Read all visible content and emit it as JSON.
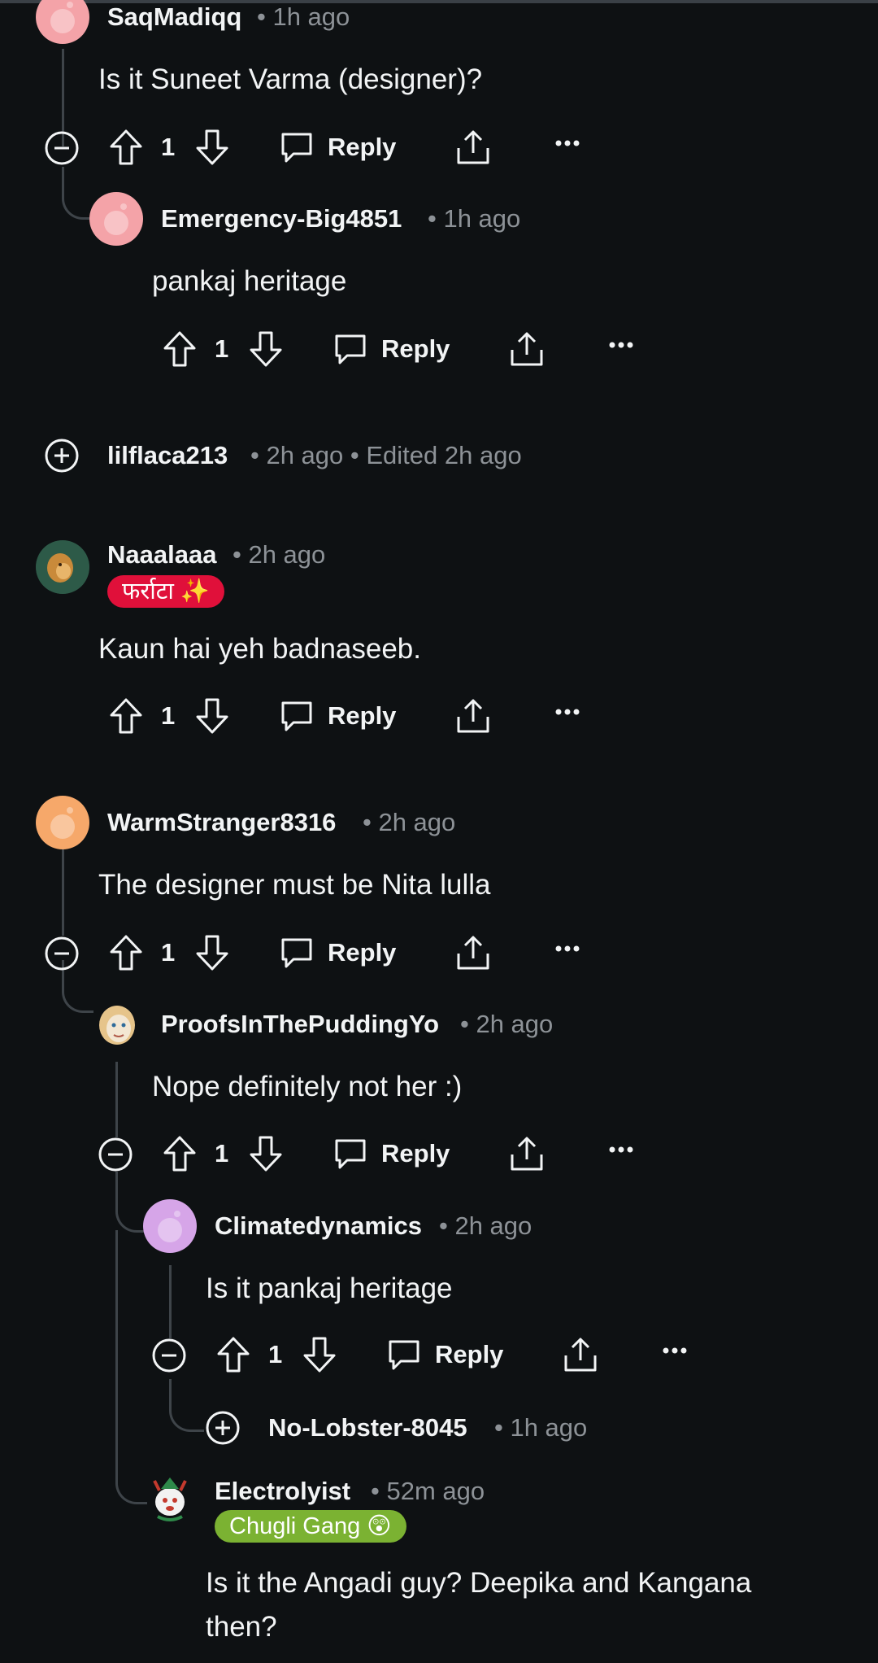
{
  "comments": [
    {
      "username": "SaqMadiqq",
      "time": "• 1h ago",
      "text": "Is it Suneet Varma (designer)?",
      "votes": "1",
      "reply_label": "Reply",
      "avatar": "pink-snoo-avatar"
    },
    {
      "username": "Emergency-Big4851",
      "time": "• 1h ago",
      "text": "pankaj heritage",
      "votes": "1",
      "reply_label": "Reply",
      "avatar": "pink-snoo-avatar"
    },
    {
      "username": "lilflaca213",
      "time": "• 2h ago • Edited 2h ago",
      "collapsed": true
    },
    {
      "username": "Naaalaaa",
      "time": "• 2h ago",
      "flair": "फर्राटा ✨",
      "text": "Kaun hai yeh badnaseeb.",
      "votes": "1",
      "reply_label": "Reply",
      "avatar": "lion-avatar"
    },
    {
      "username": "WarmStranger8316",
      "time": "• 2h ago",
      "text": "The designer must be Nita lulla",
      "votes": "1",
      "reply_label": "Reply",
      "avatar": "orange-snoo-avatar"
    },
    {
      "username": "ProofsInThePuddingYo",
      "time": "• 2h ago",
      "text": "Nope definitely not her :)",
      "votes": "1",
      "reply_label": "Reply",
      "avatar": "cartoon-avatar"
    },
    {
      "username": "Climatedynamics",
      "time": "• 2h ago",
      "text": "Is it pankaj heritage",
      "votes": "1",
      "reply_label": "Reply",
      "avatar": "purple-snoo-avatar"
    },
    {
      "username": "No-Lobster-8045",
      "time": "• 1h ago",
      "collapsed": true
    },
    {
      "username": "Electrolyist",
      "time": "• 52m ago",
      "flair": "Chugli Gang 😲",
      "text_line1": "Is it the Angadi guy? Deepika and Kangana",
      "text_line2": "then?",
      "avatar": "cartoon-reindeer-avatar"
    }
  ],
  "colors": {
    "background": "#0e1113",
    "thread_line": "#3e4449",
    "meta_text": "#8d9297",
    "flair_red": "#e0103a",
    "flair_green": "#7bb232"
  }
}
